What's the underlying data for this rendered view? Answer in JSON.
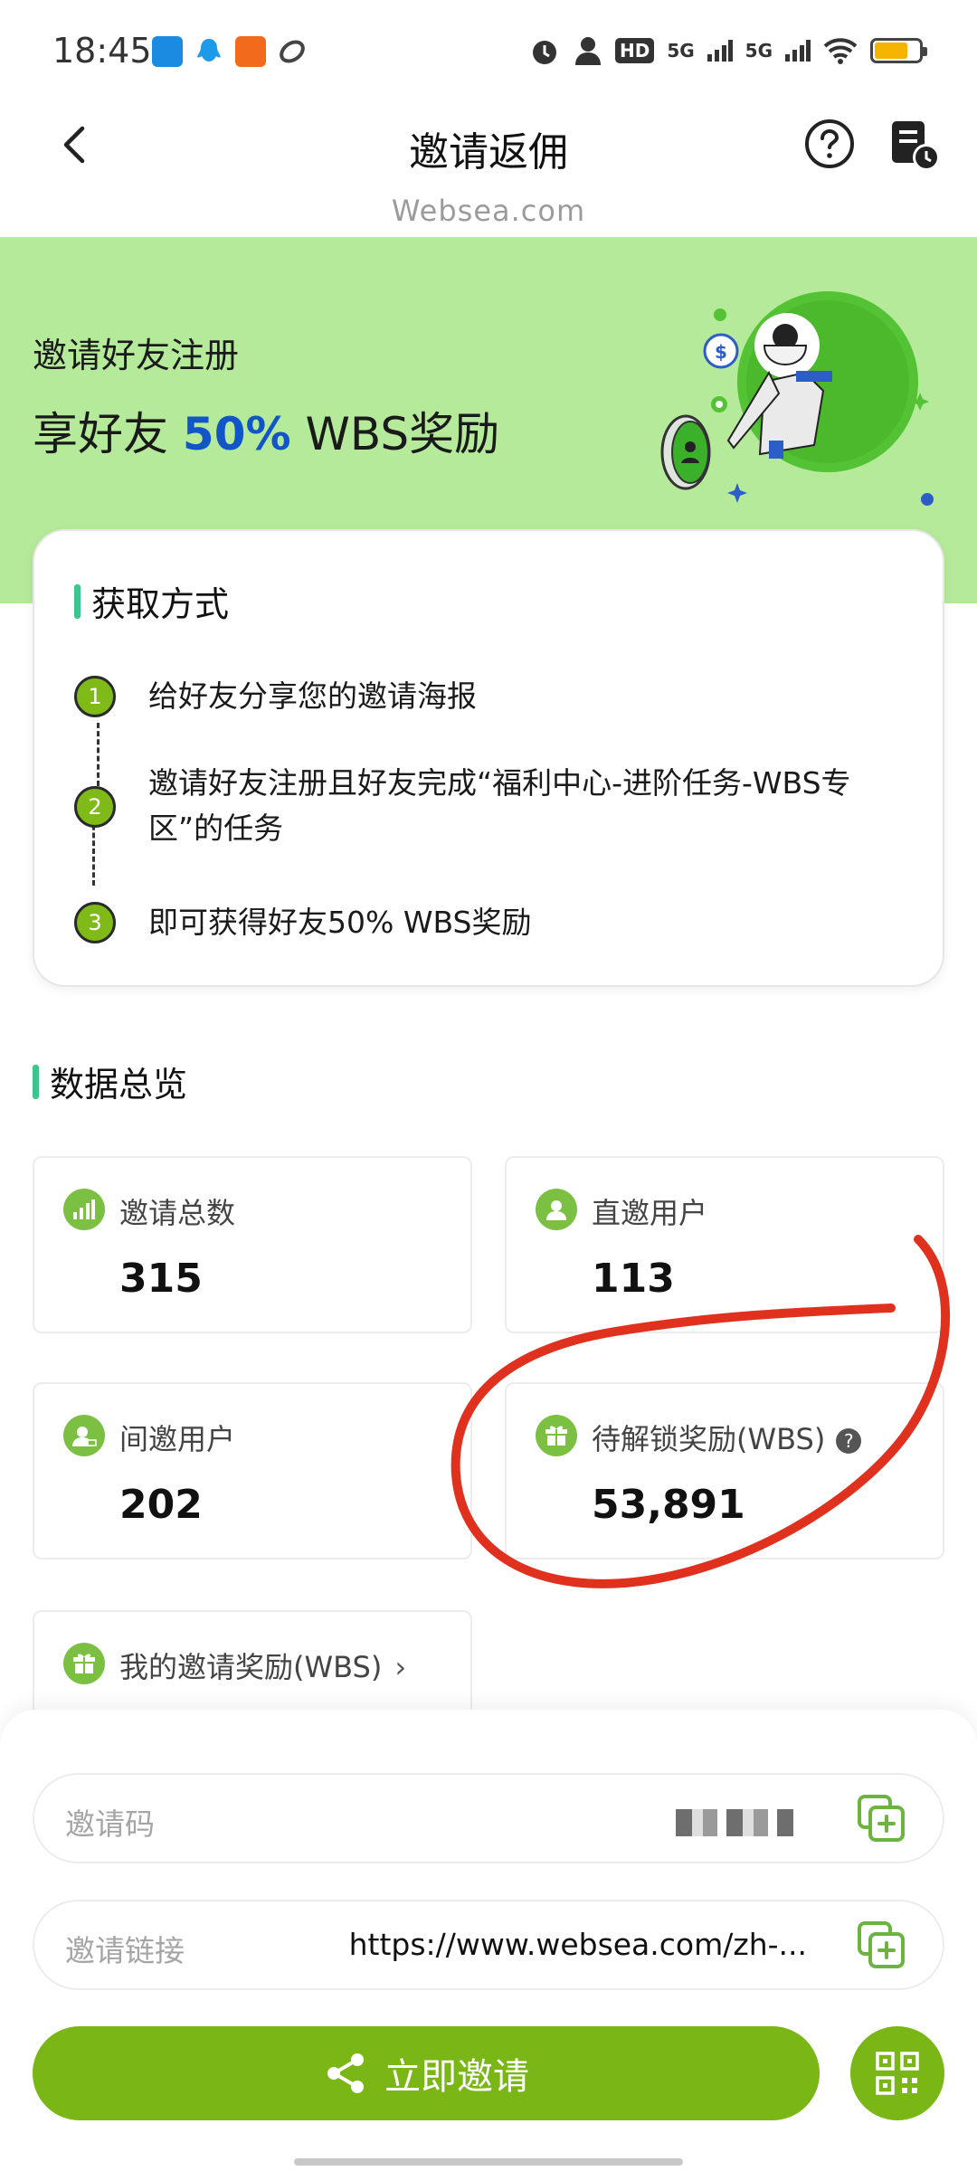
{
  "status_bar": {
    "time": "18:45",
    "network_1": "5G",
    "network_2": "5G",
    "hd_label": "HD",
    "battery_level": 0.75,
    "battery_color": "#f5b400"
  },
  "nav": {
    "title": "邀请返佣",
    "back_icon": "chevron-left-icon",
    "help_icon": "question-circle-icon",
    "record_icon": "document-clock-icon"
  },
  "watermark": "Websea.com",
  "hero": {
    "line1": "邀请好友注册",
    "line2_prefix": "享好友 ",
    "line2_accent": "50%",
    "line2_suffix": " WBS奖励",
    "accent_color": "#1255c9",
    "background": "#b4ea99"
  },
  "steps": {
    "title": "获取方式",
    "items": [
      {
        "num": "1",
        "text": "给好友分享您的邀请海报"
      },
      {
        "num": "2",
        "text": "邀请好友注册且好友完成“福利中心-进阶任务-WBS专区”的任务"
      },
      {
        "num": "3",
        "text": "即可获得好友50% WBS奖励"
      }
    ]
  },
  "overview": {
    "title": "数据总览",
    "stats": [
      {
        "label": "邀请总数",
        "value": "315",
        "icon": "signal-bars-icon"
      },
      {
        "label": "直邀用户",
        "value": "113",
        "icon": "user-icon"
      },
      {
        "label": "间邀用户",
        "value": "202",
        "icon": "user-sub-icon"
      },
      {
        "label": "待解锁奖励(WBS)",
        "value": "53,891",
        "icon": "gift-icon",
        "help": "?"
      }
    ],
    "my_reward_label": "我的邀请奖励(WBS)",
    "my_reward_chevron": "›"
  },
  "invite": {
    "code_label": "邀请码",
    "link_label": "邀请链接",
    "link_value": "https://www.websea.com/zh-...",
    "button_label": "立即邀请",
    "brand_green": "#7ab615"
  }
}
